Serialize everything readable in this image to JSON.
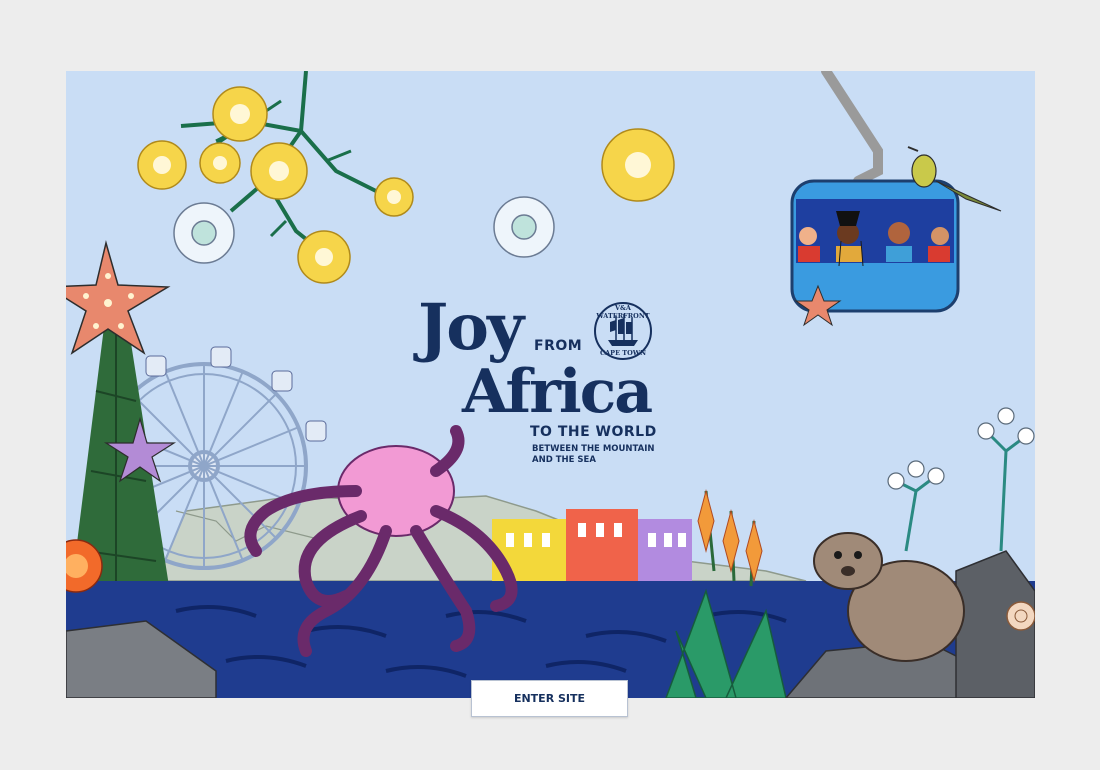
{
  "hero": {
    "title_line1": "Joy",
    "title_from": "FROM",
    "title_line2": "Africa",
    "tagline": "TO THE WORLD",
    "subtagline": "BETWEEN THE MOUNTAIN AND THE SEA",
    "badge_top": "V&A WATERFRONT",
    "badge_bottom": "CAPE TOWN"
  },
  "cta": {
    "enter_label": "ENTER SITE"
  },
  "colors": {
    "page_bg": "#ededed",
    "sky": "#c9ddf5",
    "sea": "#1f3c8f",
    "brand_navy": "#16305e",
    "cable_car": "#3a9be0",
    "octopus": "#f29ad4"
  },
  "illustrations": [
    "yellow-flower-branch",
    "white-flower-clusters",
    "starfish",
    "ferris-wheel",
    "octopus",
    "table-mountain",
    "colorful-houses",
    "aloe-plants",
    "dassie-rock-hyrax",
    "cable-car-with-passengers",
    "sunbird",
    "protea-flower",
    "seashell"
  ]
}
